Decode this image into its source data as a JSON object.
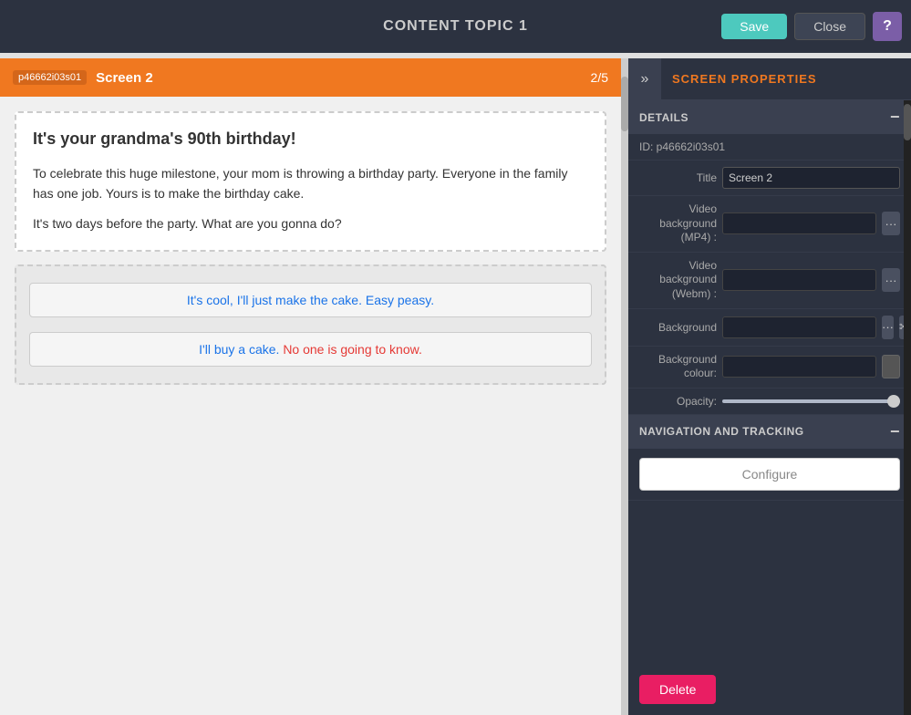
{
  "header": {
    "title": "CONTENT TOPIC 1",
    "save_label": "Save",
    "close_label": "Close",
    "help_label": "?"
  },
  "screen_bar": {
    "id_badge": "p46662i03s01",
    "title": "Screen 2",
    "counter": "2/5"
  },
  "content": {
    "main_text": "It's your grandma's 90th birthday!",
    "body_text_1": "To celebrate this huge milestone, your mom is throwing a birthday party. Everyone in the family has one job. Yours is to make the birthday cake.",
    "body_text_2": "It's two days before the party. What are you gonna do?",
    "choice_1": "It's cool, I'll just make the cake. Easy peasy.",
    "choice_2": "I'll buy a cake. No one is going to know."
  },
  "panel": {
    "title": "SCREEN PROPERTIES",
    "collapse_icon": "»",
    "details_section": "DETAILS",
    "nav_section": "NAVIGATION AND TRACKING",
    "minus_icon": "−",
    "id_label": "ID:",
    "id_value": "p46662i03s01",
    "title_label": "Title",
    "title_value": "Screen 2",
    "video_mp4_label": "Video background (MP4) :",
    "video_webm_label": "Video background (Webm) :",
    "background_label": "Background",
    "bg_color_label": "Background colour:",
    "opacity_label": "Opacity:",
    "dots_label": "...",
    "configure_label": "Configure",
    "delete_label": "Delete"
  }
}
